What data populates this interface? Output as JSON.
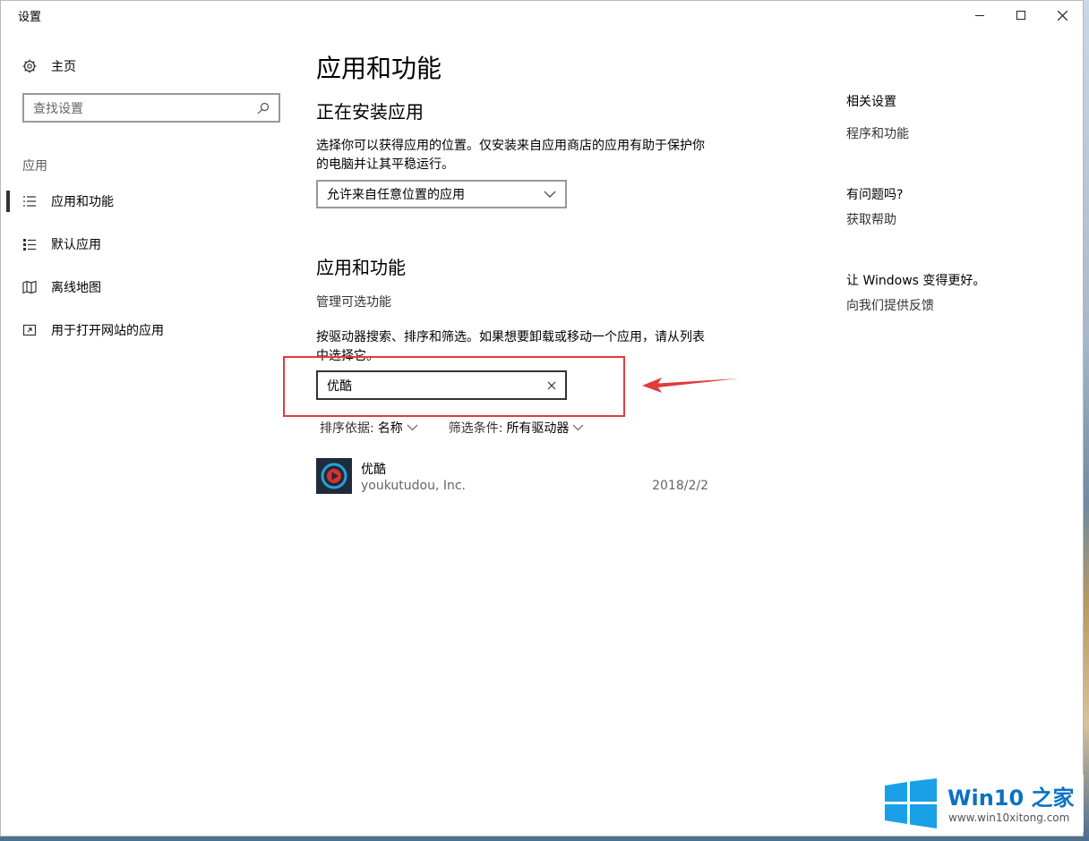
{
  "window": {
    "title": "设置"
  },
  "sidebar": {
    "home_label": "主页",
    "search_placeholder": "查找设置",
    "section_label": "应用",
    "items": [
      {
        "label": "应用和功能",
        "icon": "list-icon",
        "active": true
      },
      {
        "label": "默认应用",
        "icon": "default-apps-icon",
        "active": false
      },
      {
        "label": "离线地图",
        "icon": "map-icon",
        "active": false
      },
      {
        "label": "用于打开网站的应用",
        "icon": "open-web-icon",
        "active": false
      }
    ]
  },
  "main": {
    "title": "应用和功能",
    "install_heading": "正在安装应用",
    "install_desc": "选择你可以获得应用的位置。仅安装来自应用商店的应用有助于保护你的电脑并让其平稳运行。",
    "install_select_value": "允许来自任意位置的应用",
    "apps_heading": "应用和功能",
    "manage_optional": "管理可选功能",
    "search_desc": "按驱动器搜索、排序和筛选。如果想要卸载或移动一个应用，请从列表中选择它。",
    "search_value": "优酷",
    "sort_label": "排序依据:",
    "sort_value": "名称",
    "filter_label": "筛选条件:",
    "filter_value": "所有驱动器",
    "apps": [
      {
        "name": "优酷",
        "publisher": "youkutudou, Inc.",
        "date": "2018/2/2"
      }
    ]
  },
  "related": {
    "heading": "相关设置",
    "programs_link": "程序和功能",
    "question_heading": "有问题吗?",
    "help_link": "获取帮助",
    "improve_heading": "让 Windows 变得更好。",
    "feedback_link": "向我们提供反馈"
  },
  "watermark": {
    "brand": "Win10 之家",
    "site": "www.win10xitong.com"
  },
  "colors": {
    "highlight": "#e23b3b",
    "accent": "#0a72c2"
  }
}
